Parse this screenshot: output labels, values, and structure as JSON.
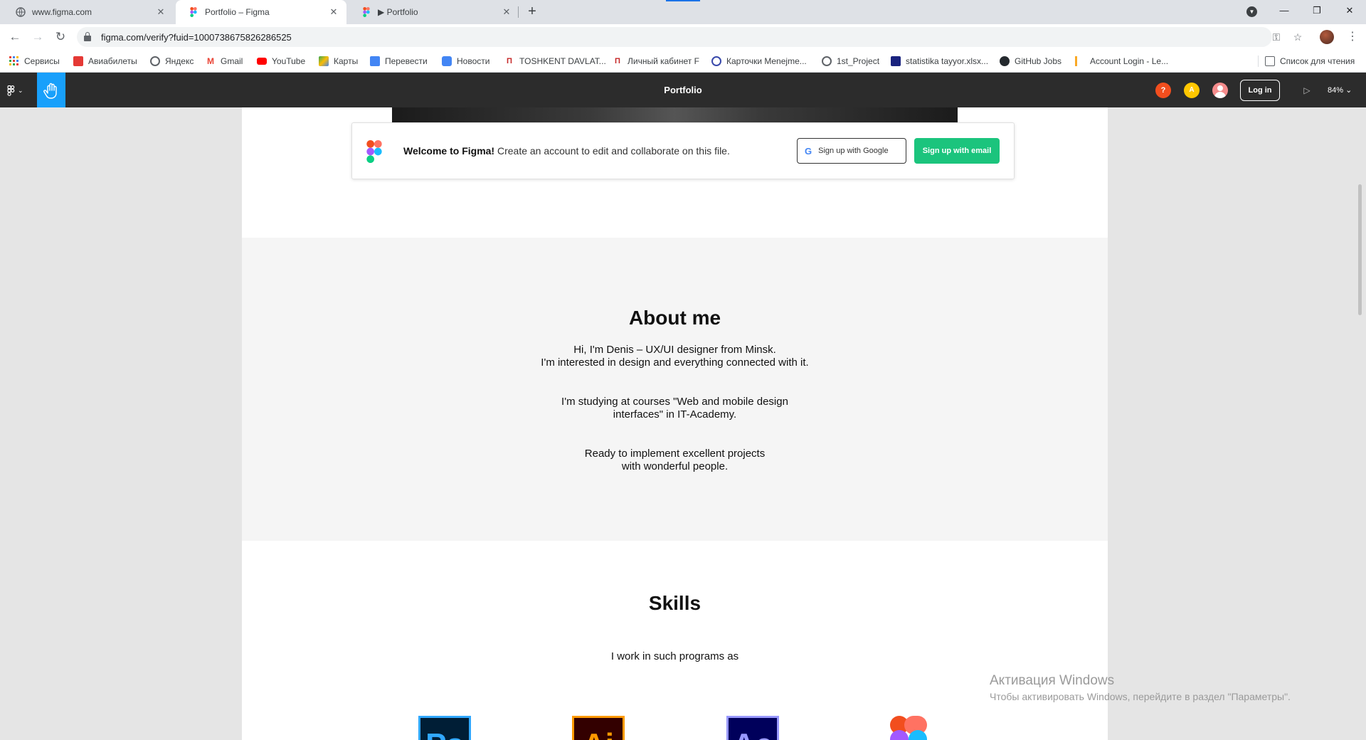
{
  "browser": {
    "tabs": [
      {
        "title": "www.figma.com",
        "active": false
      },
      {
        "title": "Portfolio – Figma",
        "active": true
      },
      {
        "title": "▶ Portfolio",
        "active": false
      }
    ],
    "url": "figma.com/verify?fuid=1000738675826286525",
    "bookmarks": [
      {
        "label": "Сервисы",
        "color": "#ea4335"
      },
      {
        "label": "Авиабилеты",
        "color": "#e53935"
      },
      {
        "label": "Яндекс",
        "color": "#5f6368"
      },
      {
        "label": "Gmail",
        "color": "#ea4335"
      },
      {
        "label": "YouTube",
        "color": "#ff0000"
      },
      {
        "label": "Карты",
        "color": "#34a853"
      },
      {
        "label": "Перевести",
        "color": "#4285f4"
      },
      {
        "label": "Новости",
        "color": "#4285f4"
      },
      {
        "label": "TOSHKENT DAVLAT...",
        "color": "#c62828"
      },
      {
        "label": "Личный кабинет F",
        "color": "#c62828"
      },
      {
        "label": "Карточки Menejme...",
        "color": "#3949ab"
      },
      {
        "label": "1st_Project",
        "color": "#5f6368"
      },
      {
        "label": "statistika tayyor.xlsx...",
        "color": "#1a237e"
      },
      {
        "label": "GitHub Jobs",
        "color": "#24292e"
      },
      {
        "label": "Account Login - Le...",
        "color": "#f9a825"
      }
    ],
    "reading_list": "Список для чтения"
  },
  "figma": {
    "title": "Portfolio",
    "help": "?",
    "avatar_letter": "A",
    "login_label": "Log in",
    "zoom": "84% ⌄",
    "welcome": {
      "bold": "Welcome to Figma!",
      "text": " Create an account to edit and collaborate on this file.",
      "google_label": "Sign up with Google",
      "email_label": "Sign up with email"
    }
  },
  "portfolio": {
    "about_title": "About me",
    "about_p1_l1": "Hi, I'm Denis – UX/UI designer from Minsk.",
    "about_p1_l2": "I'm interested in design and everything connected with it.",
    "about_p2_l1": "I'm studying at courses \"Web and mobile design",
    "about_p2_l2": "interfaces\" in IT-Academy.",
    "about_p3_l1": "Ready to implement excellent projects",
    "about_p3_l2": "with wonderful people.",
    "skills_title": "Skills",
    "skills_sub": "I work in such programs as",
    "apps": [
      "Ps",
      "Ai",
      "Ae"
    ]
  },
  "windows_watermark": {
    "line1": "Активация Windows",
    "line2": "Чтобы активировать Windows, перейдите в раздел \"Параметры\"."
  }
}
